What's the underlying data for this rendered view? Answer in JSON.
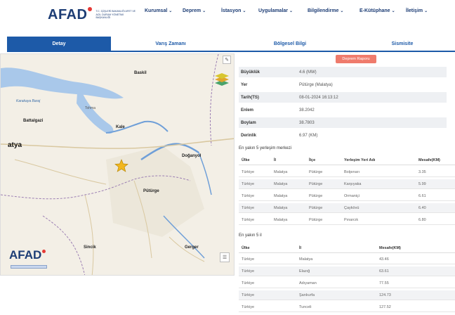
{
  "header": {
    "logo_text": "AFAD",
    "logo_sub": "T.C. İÇİŞLERİ BAKANLIĞI AFET VE ACİL DURUM YÖNETİMİ BAŞKANLIĞI",
    "nav": [
      {
        "label": "Kurumsal"
      },
      {
        "label": "Deprem"
      },
      {
        "label": "İstasyon"
      },
      {
        "label": "Uygulamalar"
      },
      {
        "label": "Bilgilendirme"
      },
      {
        "label": "E-Kütüphane"
      },
      {
        "label": "İletişim"
      }
    ]
  },
  "tabs": [
    {
      "label": "Detay",
      "active": true
    },
    {
      "label": "Varış Zamanı",
      "active": false
    },
    {
      "label": "Bölgesel Bilgi",
      "active": false
    },
    {
      "label": "Sismisite",
      "active": false
    }
  ],
  "map": {
    "labels": {
      "baskil": "Baskil",
      "karakaya": "Karakaya Baraj",
      "battalgazi": "Battalgazi",
      "kale": "Kale",
      "atya": "atya",
      "doganyol": "Doğanyol",
      "puturge": "Pütürge",
      "sincik": "Sincik",
      "gerger": "Gerger",
      "tohma": "Tohma"
    },
    "logo_text": "AFAD",
    "icons": [
      "pencil-icon",
      "layers-icon",
      "list-icon",
      "star-icon"
    ]
  },
  "report_button": "Deprem Raporu",
  "details": [
    {
      "key": "Büyüklük",
      "value": "4.6 (MW)"
    },
    {
      "key": "Yer",
      "value": "Pütürge (Malatya)"
    },
    {
      "key": "Tarih(TS)",
      "value": "08-01-2024 16:13:12"
    },
    {
      "key": "Enlem",
      "value": "38.2042"
    },
    {
      "key": "Boylam",
      "value": "38.7803"
    },
    {
      "key": "Derinlik",
      "value": "6.97 (KM)"
    }
  ],
  "nearest_settlements": {
    "title": "En yakın 5 yerleşim merkezi",
    "columns": [
      "Ülke",
      "İl",
      "İlçe",
      "Yerleşim Yeri Adı",
      "Mesafe(KM)"
    ],
    "rows": [
      [
        "Türkiye",
        "Malatya",
        "Pütürge",
        "Bolpınarı",
        "3.35"
      ],
      [
        "Türkiye",
        "Malatya",
        "Pütürge",
        "Karşıyaka",
        "5.99"
      ],
      [
        "Türkiye",
        "Malatya",
        "Pütürge",
        "Ormaniçi",
        "6.61"
      ],
      [
        "Türkiye",
        "Malatya",
        "Pütürge",
        "Çaykövü",
        "6.40"
      ],
      [
        "Türkiye",
        "Malatya",
        "Pütürge",
        "Pınarcık",
        "6.80"
      ]
    ]
  },
  "nearest_provinces": {
    "title": "En yakın 5 il",
    "columns": [
      "Ülke",
      "İl",
      "Mesafe(KM)"
    ],
    "rows": [
      [
        "Türkiye",
        "Malatya",
        "43.46"
      ],
      [
        "Türkiye",
        "Elazığ",
        "63.61"
      ],
      [
        "Türkiye",
        "Adıyaman",
        "77.55"
      ],
      [
        "Türkiye",
        "Şanlıurfa",
        "124.73"
      ],
      [
        "Türkiye",
        "Tunceli",
        "127.52"
      ]
    ]
  },
  "colors": {
    "brand": "#1d3d75",
    "tab_active": "#1d5aa8",
    "report_button": "#ef7b6c",
    "water": "#a9c8ea",
    "epicenter": "#f2b71f"
  }
}
